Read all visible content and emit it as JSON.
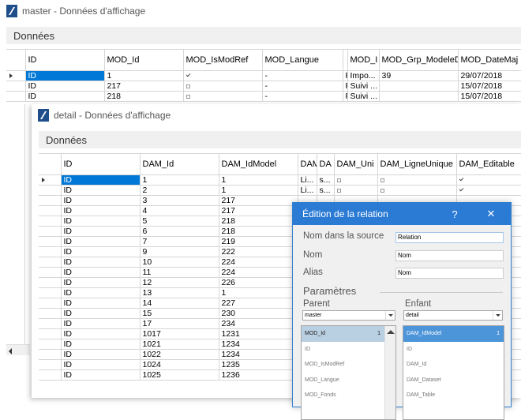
{
  "master": {
    "title": "master - Données d'affichage",
    "section": "Données",
    "columns": [
      "ID",
      "MOD_Id",
      "MOD_IsModRef",
      "MOD_Langue",
      "",
      "MOD_I",
      "MOD_Grp_ModeleD",
      "MOD_DateMaj"
    ],
    "rows": [
      [
        "ID",
        "1",
        "on",
        "-",
        "F",
        "Impo...",
        "39",
        "29/07/2018"
      ],
      [
        "ID",
        "217",
        "off",
        "-",
        "F",
        "Suivi ...",
        "",
        "15/07/2018"
      ],
      [
        "ID",
        "218",
        "off",
        "-",
        "F",
        "Suivi ...",
        "",
        "15/07/2018"
      ]
    ]
  },
  "detail": {
    "title": "detail - Données d'affichage",
    "section": "Données",
    "columns": [
      "ID",
      "DAM_Id",
      "DAM_IdModel",
      "DAM",
      "DA",
      "DAM_Uni",
      "DAM_LigneUnique",
      "DAM_Editable"
    ],
    "rows": [
      [
        "ID",
        "1",
        "1",
        "Li...",
        "s...",
        "off",
        "off",
        "on"
      ],
      [
        "ID",
        "2",
        "1",
        "Li...",
        "s...",
        "off",
        "off",
        "on"
      ],
      [
        "ID",
        "3",
        "217",
        "",
        "",
        "",
        "",
        ""
      ],
      [
        "ID",
        "4",
        "217",
        "",
        "",
        "",
        "",
        ""
      ],
      [
        "ID",
        "5",
        "218",
        "",
        "",
        "",
        "",
        ""
      ],
      [
        "ID",
        "6",
        "218",
        "",
        "",
        "",
        "",
        ""
      ],
      [
        "ID",
        "7",
        "219",
        "",
        "",
        "",
        "",
        ""
      ],
      [
        "ID",
        "9",
        "222",
        "",
        "",
        "",
        "",
        ""
      ],
      [
        "ID",
        "10",
        "224",
        "",
        "",
        "",
        "",
        ""
      ],
      [
        "ID",
        "11",
        "224",
        "",
        "",
        "",
        "",
        ""
      ],
      [
        "ID",
        "12",
        "226",
        "",
        "",
        "",
        "",
        ""
      ],
      [
        "ID",
        "13",
        "1",
        "",
        "",
        "",
        "",
        ""
      ],
      [
        "ID",
        "14",
        "227",
        "",
        "",
        "",
        "",
        ""
      ],
      [
        "ID",
        "15",
        "230",
        "",
        "",
        "",
        "",
        ""
      ],
      [
        "ID",
        "17",
        "234",
        "",
        "",
        "",
        "",
        ""
      ],
      [
        "ID",
        "1017",
        "1231",
        "",
        "",
        "",
        "",
        ""
      ],
      [
        "ID",
        "1021",
        "1234",
        "",
        "",
        "",
        "",
        ""
      ],
      [
        "ID",
        "1022",
        "1234",
        "",
        "",
        "",
        "",
        ""
      ],
      [
        "ID",
        "1024",
        "1235",
        "",
        "",
        "",
        "",
        ""
      ],
      [
        "ID",
        "1025",
        "1236",
        "",
        "",
        "",
        "",
        ""
      ]
    ]
  },
  "dialog": {
    "title": "Édition de la relation",
    "help": "?",
    "close": "✕",
    "fields": [
      {
        "label": "Nom dans la source",
        "value": "Relation"
      },
      {
        "label": "Nom",
        "value": "Nom"
      },
      {
        "label": "Alias",
        "value": "Nom"
      }
    ],
    "params_title": "Paramètres",
    "parent_label": "Parent",
    "child_label": "Enfant",
    "parent_value": "master",
    "child_value": "detail",
    "parent_items": [
      {
        "text": "MOD_Id",
        "num": "1"
      },
      {
        "text": "ID",
        "num": ""
      },
      {
        "text": "MOD_IsModRef",
        "num": ""
      },
      {
        "text": "MOD_Langue",
        "num": ""
      },
      {
        "text": "MOD_Fonds",
        "num": ""
      }
    ],
    "child_items": [
      {
        "text": "DAM_IdModel",
        "num": "1"
      },
      {
        "text": "ID",
        "num": ""
      },
      {
        "text": "DAM_Id",
        "num": ""
      },
      {
        "text": "DAM_Dataset",
        "num": ""
      },
      {
        "text": "DAM_Table",
        "num": ""
      }
    ]
  },
  "colors": {
    "selection": "#0078d7",
    "dialog_title": "#2b7bd4"
  }
}
